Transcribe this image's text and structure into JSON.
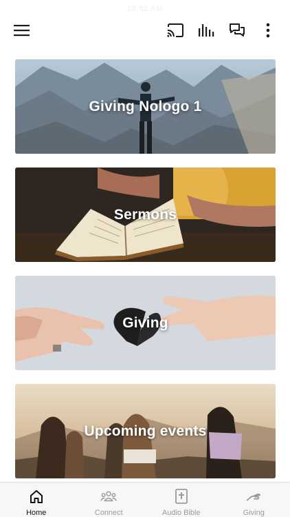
{
  "status": {
    "time": "10:52 AM"
  },
  "header": {
    "menu_icon": "menu-icon",
    "cast_icon": "cast-icon",
    "audio_icon": "audio-bars-icon",
    "chat_icon": "chat-icon",
    "more_icon": "more-vertical-icon"
  },
  "cards": [
    {
      "title": "Giving Nologo 1",
      "image": "man-on-mountain"
    },
    {
      "title": "Sermons",
      "image": "open-bible"
    },
    {
      "title": "Giving",
      "image": "hands-with-heart"
    },
    {
      "title": "Upcoming events",
      "image": "group-at-sunset"
    }
  ],
  "tabs": [
    {
      "label": "Home",
      "icon": "home-icon",
      "active": true
    },
    {
      "label": "Connect",
      "icon": "people-icon",
      "active": false
    },
    {
      "label": "Audio Bible",
      "icon": "bible-icon",
      "active": false
    },
    {
      "label": "Giving",
      "icon": "giving-hand-icon",
      "active": false
    }
  ],
  "colors": {
    "active_tab": "#111111",
    "inactive_tab": "#9a9a9a",
    "icon": "#1a1a1a"
  }
}
